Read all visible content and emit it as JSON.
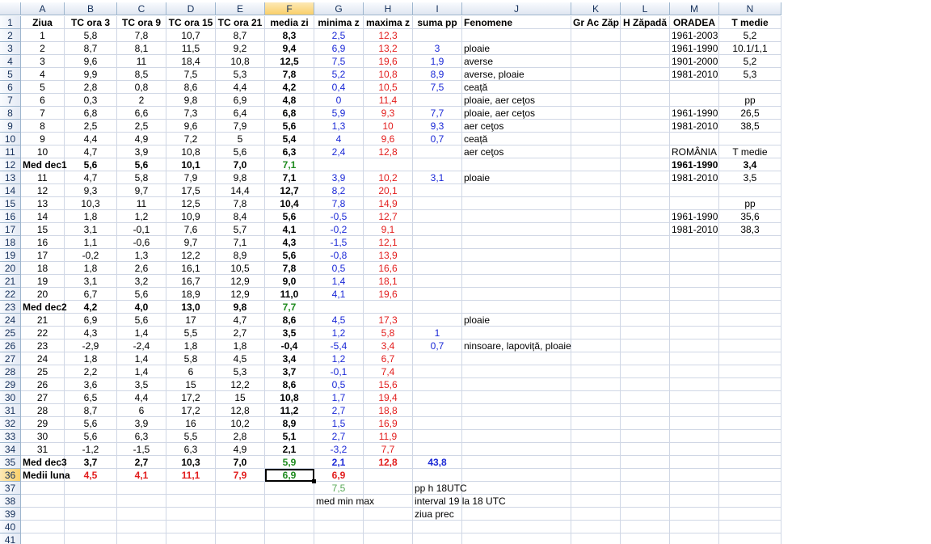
{
  "columns": [
    "A",
    "B",
    "C",
    "D",
    "E",
    "F",
    "G",
    "H",
    "I",
    "J",
    "K",
    "L",
    "M",
    "N"
  ],
  "header_row": [
    "Ziua",
    "TC ora 3",
    "TC ora 9",
    "TC ora 15",
    "TC ora 21",
    "media zi",
    "minima z",
    "maxima z",
    "suma pp",
    "Fenomene",
    "Gr Ac Zăp",
    "H Zăpadă",
    "ORADEA",
    "T medie"
  ],
  "rows": [
    [
      "1",
      "5,8",
      "7,8",
      "10,7",
      "8,7",
      "8,3",
      "2,5",
      "12,3",
      "",
      "",
      "",
      "",
      "1961-2003",
      "5,2"
    ],
    [
      "2",
      "8,7",
      "8,1",
      "11,5",
      "9,2",
      "9,4",
      "6,9",
      "13,2",
      "3",
      "ploaie",
      "",
      "",
      "1961-1990",
      "10.1/1,1"
    ],
    [
      "3",
      "9,6",
      "11",
      "18,4",
      "10,8",
      "12,5",
      "7,5",
      "19,6",
      "1,9",
      "averse",
      "",
      "",
      "1901-2000",
      "5,2"
    ],
    [
      "4",
      "9,9",
      "8,5",
      "7,5",
      "5,3",
      "7,8",
      "5,2",
      "10,8",
      "8,9",
      "averse, ploaie",
      "",
      "",
      "1981-2010",
      "5,3"
    ],
    [
      "5",
      "2,8",
      "0,8",
      "8,6",
      "4,4",
      "4,2",
      "0,4",
      "10,5",
      "7,5",
      "ceață",
      "",
      "",
      "",
      ""
    ],
    [
      "6",
      "0,3",
      "2",
      "9,8",
      "6,9",
      "4,8",
      "0",
      "11,4",
      "",
      "ploaie, aer ceţos",
      "",
      "",
      "",
      "pp"
    ],
    [
      "7",
      "6,8",
      "6,6",
      "7,3",
      "6,4",
      "6,8",
      "5,9",
      "9,3",
      "7,7",
      "ploaie, aer ceţos",
      "",
      "",
      "1961-1990",
      "26,5"
    ],
    [
      "8",
      "2,5",
      "2,5",
      "9,6",
      "7,9",
      "5,6",
      "1,3",
      "10",
      "9,3",
      "aer ceţos",
      "",
      "",
      "1981-2010",
      "38,5"
    ],
    [
      "9",
      "4,4",
      "4,9",
      "7,2",
      "5",
      "5,4",
      "4",
      "9,6",
      "0,7",
      "ceață",
      "",
      "",
      "",
      ""
    ],
    [
      "10",
      "4,7",
      "3,9",
      "10,8",
      "5,6",
      "6,3",
      "2,4",
      "12,8",
      "",
      "aer ceţos",
      "",
      "",
      "ROMÂNIA",
      "T medie"
    ],
    [
      "Med dec1",
      "5,6",
      "5,6",
      "10,1",
      "7,0",
      "7,1",
      "",
      "",
      "",
      "",
      "",
      "",
      "1961-1990",
      "3,4"
    ],
    [
      "11",
      "4,7",
      "5,8",
      "7,9",
      "9,8",
      "7,1",
      "3,9",
      "10,2",
      "3,1",
      "ploaie",
      "",
      "",
      "1981-2010",
      "3,5"
    ],
    [
      "12",
      "9,3",
      "9,7",
      "17,5",
      "14,4",
      "12,7",
      "8,2",
      "20,1",
      "",
      "",
      "",
      "",
      "",
      ""
    ],
    [
      "13",
      "10,3",
      "11",
      "12,5",
      "7,8",
      "10,4",
      "7,8",
      "14,9",
      "",
      "",
      "",
      "",
      "",
      "pp"
    ],
    [
      "14",
      "1,8",
      "1,2",
      "10,9",
      "8,4",
      "5,6",
      "-0,5",
      "12,7",
      "",
      "",
      "",
      "",
      "1961-1990",
      "35,6"
    ],
    [
      "15",
      "3,1",
      "-0,1",
      "7,6",
      "5,7",
      "4,1",
      "-0,2",
      "9,1",
      "",
      "",
      "",
      "",
      "1981-2010",
      "38,3"
    ],
    [
      "16",
      "1,1",
      "-0,6",
      "9,7",
      "7,1",
      "4,3",
      "-1,5",
      "12,1",
      "",
      "",
      "",
      "",
      "",
      ""
    ],
    [
      "17",
      "-0,2",
      "1,3",
      "12,2",
      "8,9",
      "5,6",
      "-0,8",
      "13,9",
      "",
      "",
      "",
      "",
      "",
      ""
    ],
    [
      "18",
      "1,8",
      "2,6",
      "16,1",
      "10,5",
      "7,8",
      "0,5",
      "16,6",
      "",
      "",
      "",
      "",
      "",
      ""
    ],
    [
      "19",
      "3,1",
      "3,2",
      "16,7",
      "12,9",
      "9,0",
      "1,4",
      "18,1",
      "",
      "",
      "",
      "",
      "",
      ""
    ],
    [
      "20",
      "6,7",
      "5,6",
      "18,9",
      "12,9",
      "11,0",
      "4,1",
      "19,6",
      "",
      "",
      "",
      "",
      "",
      ""
    ],
    [
      "Med dec2",
      "4,2",
      "4,0",
      "13,0",
      "9,8",
      "7,7",
      "",
      "",
      "",
      "",
      "",
      "",
      "",
      ""
    ],
    [
      "21",
      "6,9",
      "5,6",
      "17",
      "4,7",
      "8,6",
      "4,5",
      "17,3",
      "",
      "ploaie",
      "",
      "",
      "",
      ""
    ],
    [
      "22",
      "4,3",
      "1,4",
      "5,5",
      "2,7",
      "3,5",
      "1,2",
      "5,8",
      "1",
      "",
      "",
      "",
      "",
      ""
    ],
    [
      "23",
      "-2,9",
      "-2,4",
      "1,8",
      "1,8",
      "-0,4",
      "-5,4",
      "3,4",
      "0,7",
      "ninsoare, lapoviță, ploaie",
      "",
      "",
      "",
      ""
    ],
    [
      "24",
      "1,8",
      "1,4",
      "5,8",
      "4,5",
      "3,4",
      "1,2",
      "6,7",
      "",
      "",
      "",
      "",
      "",
      ""
    ],
    [
      "25",
      "2,2",
      "1,4",
      "6",
      "5,3",
      "3,7",
      "-0,1",
      "7,4",
      "",
      "",
      "",
      "",
      "",
      ""
    ],
    [
      "26",
      "3,6",
      "3,5",
      "15",
      "12,2",
      "8,6",
      "0,5",
      "15,6",
      "",
      "",
      "",
      "",
      "",
      ""
    ],
    [
      "27",
      "6,5",
      "4,4",
      "17,2",
      "15",
      "10,8",
      "1,7",
      "19,4",
      "",
      "",
      "",
      "",
      "",
      ""
    ],
    [
      "28",
      "8,7",
      "6",
      "17,2",
      "12,8",
      "11,2",
      "2,7",
      "18,8",
      "",
      "",
      "",
      "",
      "",
      ""
    ],
    [
      "29",
      "5,6",
      "3,9",
      "16",
      "10,2",
      "8,9",
      "1,5",
      "16,9",
      "",
      "",
      "",
      "",
      "",
      ""
    ],
    [
      "30",
      "5,6",
      "6,3",
      "5,5",
      "2,8",
      "5,1",
      "2,7",
      "11,9",
      "",
      "",
      "",
      "",
      "",
      ""
    ],
    [
      "31",
      "-1,2",
      "-1,5",
      "6,3",
      "4,9",
      "2,1",
      "-3,2",
      "7,7",
      "",
      "",
      "",
      "",
      "",
      ""
    ],
    [
      "Med dec3",
      "3,7",
      "2,7",
      "10,3",
      "7,0",
      "5,9",
      "2,1",
      "12,8",
      "43,8",
      "",
      "",
      "",
      "",
      ""
    ],
    [
      "Medii luna",
      "4,5",
      "4,1",
      "11,1",
      "7,9",
      "6,9",
      "6,9",
      "",
      "",
      "",
      "",
      "",
      "",
      ""
    ],
    [
      "",
      "",
      "",
      "",
      "",
      "",
      "7,5",
      "",
      "pp h 18UTC",
      "",
      "",
      "",
      "",
      ""
    ],
    [
      "",
      "",
      "",
      "",
      "",
      "",
      "med min max",
      "",
      "interval 19 la 18 UTC",
      "",
      "",
      "",
      "",
      ""
    ],
    [
      "",
      "",
      "",
      "",
      "",
      "",
      "",
      "",
      "ziua prec",
      "",
      "",
      "",
      "",
      ""
    ],
    [
      "",
      "",
      "",
      "",
      "",
      "",
      "",
      "",
      "",
      "",
      "",
      "",
      "",
      ""
    ],
    [
      "",
      "",
      "",
      "",
      "",
      "",
      "",
      "",
      "",
      "",
      "",
      "",
      "",
      ""
    ]
  ],
  "row_numbers": [
    "1",
    "2",
    "3",
    "4",
    "5",
    "6",
    "7",
    "8",
    "9",
    "10",
    "11",
    "12",
    "13",
    "14",
    "15",
    "16",
    "17",
    "18",
    "19",
    "20",
    "21",
    "22",
    "23",
    "24",
    "25",
    "26",
    "27",
    "28",
    "29",
    "30",
    "31",
    "32",
    "33",
    "34",
    "35",
    "36",
    "37",
    "38",
    "39",
    "40",
    "41"
  ],
  "selected_cell": "F36",
  "colors": {
    "red": "#e21d1d",
    "blue": "#1a28d6",
    "green": "#1d8a1d",
    "header_bg": "#dfe6f1",
    "grid": "#d0d7e5"
  }
}
